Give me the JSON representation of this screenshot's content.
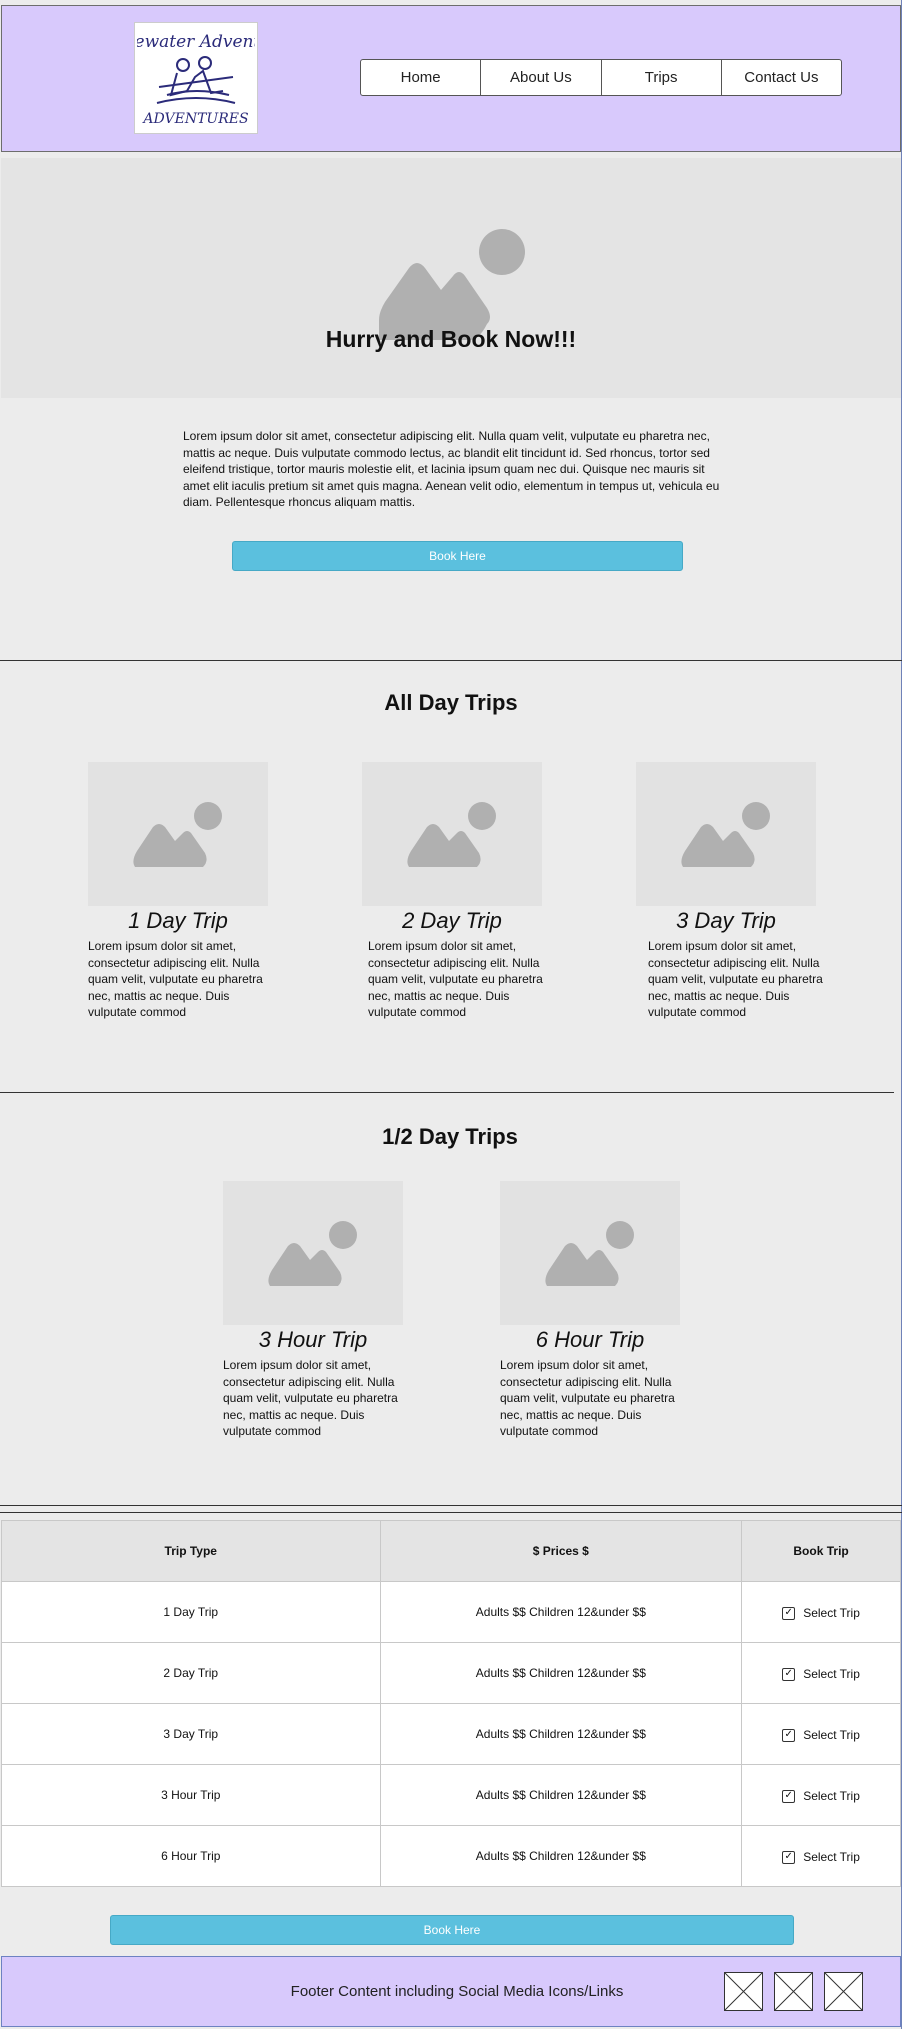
{
  "header": {
    "logo_alt": "Whitewater Adventures",
    "nav": [
      "Home",
      "About Us",
      "Trips",
      "Contact Us"
    ]
  },
  "hero": {
    "title": "Hurry and Book Now!!!",
    "intro": "Lorem ipsum dolor sit amet, consectetur adipiscing elit. Nulla quam velit, vulputate eu pharetra nec, mattis ac neque. Duis vulputate commodo lectus, ac blandit elit tincidunt id. Sed rhoncus, tortor sed eleifend tristique, tortor mauris molestie elit, et lacinia ipsum quam nec dui. Quisque nec mauris sit amet elit iaculis pretium sit amet quis magna. Aenean velit odio, elementum in tempus ut, vehicula eu diam. Pellentesque rhoncus aliquam mattis.",
    "book_label": "Book Here"
  },
  "all_day": {
    "title": "All Day Trips",
    "cards": [
      {
        "title": "1 Day Trip",
        "text": "Lorem ipsum dolor sit amet, consectetur adipiscing elit. Nulla quam velit, vulputate eu pharetra nec, mattis ac neque. Duis vulputate commod"
      },
      {
        "title": "2 Day Trip",
        "text": "Lorem ipsum dolor sit amet, consectetur adipiscing elit. Nulla quam velit, vulputate eu pharetra nec, mattis ac neque. Duis vulputate commod"
      },
      {
        "title": "3 Day Trip",
        "text": "Lorem ipsum dolor sit amet, consectetur adipiscing elit. Nulla quam velit, vulputate eu pharetra nec, mattis ac neque. Duis vulputate commod"
      }
    ]
  },
  "half_day": {
    "title": "1/2 Day Trips",
    "cards": [
      {
        "title": "3 Hour Trip",
        "text": "Lorem ipsum dolor sit amet, consectetur adipiscing elit. Nulla quam velit, vulputate eu pharetra nec, mattis ac neque. Duis vulputate commod"
      },
      {
        "title": "6 Hour Trip",
        "text": "Lorem ipsum dolor sit amet, consectetur adipiscing elit. Nulla quam velit, vulputate eu pharetra nec, mattis ac neque. Duis vulputate commod"
      }
    ]
  },
  "table": {
    "headers": [
      "Trip Type",
      "$ Prices $",
      "Book Trip"
    ],
    "rows": [
      {
        "type": "1 Day Trip",
        "price": "Adults $$ Children 12&under $$",
        "select": "Select Trip"
      },
      {
        "type": "2 Day Trip",
        "price": "Adults $$ Children 12&under $$",
        "select": "Select Trip"
      },
      {
        "type": "3 Day Trip",
        "price": "Adults $$ Children 12&under $$",
        "select": "Select Trip"
      },
      {
        "type": "3 Hour Trip",
        "price": "Adults $$ Children 12&under $$",
        "select": "Select Trip"
      },
      {
        "type": "6 Hour Trip",
        "price": "Adults $$ Children 12&under $$",
        "select": "Select Trip"
      }
    ],
    "book_label": "Book Here"
  },
  "footer": {
    "text": "Footer Content including Social Media Icons/Links"
  },
  "colors": {
    "header_bg": "#d8c9fc",
    "button_bg": "#5bc0de",
    "placeholder_gray": "#b0b0b0"
  }
}
